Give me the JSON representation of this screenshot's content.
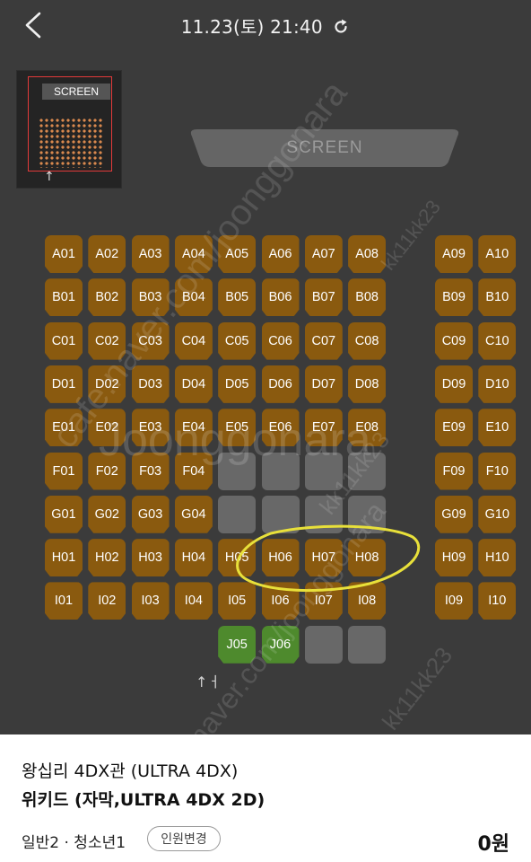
{
  "header": {
    "title": "11.23(토) 21:40",
    "back_icon": "chevron-left-icon",
    "refresh_icon": "refresh-icon"
  },
  "minimap": {
    "screen_label": "SCREEN"
  },
  "screen": {
    "label": "SCREEN"
  },
  "seat_rows": [
    {
      "row": "A",
      "left": [
        "A01",
        "A02",
        "A03",
        "A04",
        "A05",
        "A06",
        "A07",
        "A08"
      ],
      "right": [
        "A09",
        "A10"
      ]
    },
    {
      "row": "B",
      "left": [
        "B01",
        "B02",
        "B03",
        "B04",
        "B05",
        "B06",
        "B07",
        "B08"
      ],
      "right": [
        "B09",
        "B10"
      ]
    },
    {
      "row": "C",
      "left": [
        "C01",
        "C02",
        "C03",
        "C04",
        "C05",
        "C06",
        "C07",
        "C08"
      ],
      "right": [
        "C09",
        "C10"
      ]
    },
    {
      "row": "D",
      "left": [
        "D01",
        "D02",
        "D03",
        "D04",
        "D05",
        "D06",
        "D07",
        "D08"
      ],
      "right": [
        "D09",
        "D10"
      ]
    },
    {
      "row": "E",
      "left": [
        "E01",
        "E02",
        "E03",
        "E04",
        "E05",
        "E06",
        "E07",
        "E08"
      ],
      "right": [
        "E09",
        "E10"
      ]
    },
    {
      "row": "F",
      "left": [
        "F01",
        "F02",
        "F03",
        "F04",
        "",
        "",
        "",
        ""
      ],
      "right": [
        "F09",
        "F10"
      ]
    },
    {
      "row": "G",
      "left": [
        "G01",
        "G02",
        "G03",
        "G04",
        "",
        "",
        "",
        ""
      ],
      "right": [
        "G09",
        "G10"
      ]
    },
    {
      "row": "H",
      "left": [
        "H01",
        "H02",
        "H03",
        "H04",
        "H05",
        "H06",
        "H07",
        "H08"
      ],
      "right": [
        "H09",
        "H10"
      ]
    },
    {
      "row": "I",
      "left": [
        "I01",
        "I02",
        "I03",
        "I04",
        "I05",
        "I06",
        "I07",
        "I08"
      ],
      "right": [
        "I09",
        "I10"
      ]
    },
    {
      "row": "J",
      "left": [
        "",
        "",
        "",
        "",
        "J05",
        "J06",
        "",
        ""
      ],
      "right": []
    }
  ],
  "selected_seats": [
    "J05",
    "J06"
  ],
  "colors": {
    "available": "#8a5a0f",
    "sold": "#686868",
    "selected": "#4e8a2d",
    "highlight": "#e8e03a"
  },
  "watermarks": {
    "primary": "Joonggonara",
    "site": "cafe.naver.com/joonggonara",
    "user": "kk11kk23"
  },
  "booking": {
    "theater": "왕십리 4DX관 (ULTRA 4DX)",
    "movie": "위키드 (자막,ULTRA 4DX 2D)",
    "audience": "일반2 · 청소년1",
    "change_label": "인원변경",
    "price": "0원"
  }
}
